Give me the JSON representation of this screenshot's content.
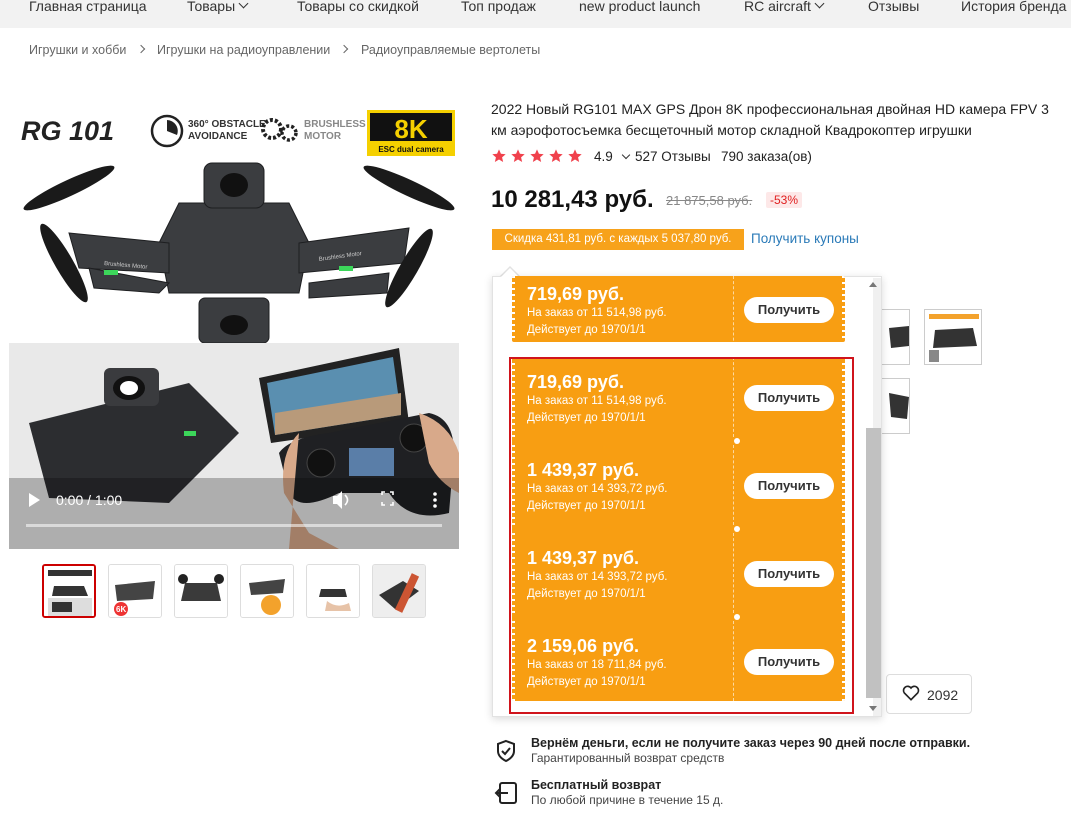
{
  "nav": {
    "items": [
      {
        "label": "Главная страница",
        "has_menu": false
      },
      {
        "label": "Товары",
        "has_menu": true
      },
      {
        "label": "Товары со скидкой",
        "has_menu": false
      },
      {
        "label": "Топ продаж",
        "has_menu": false
      },
      {
        "label": "new product launch",
        "has_menu": false
      },
      {
        "label": "RC aircraft",
        "has_menu": true
      },
      {
        "label": "Отзывы",
        "has_menu": false
      },
      {
        "label": "История бренда",
        "has_menu": false
      }
    ]
  },
  "breadcrumb": [
    "Игрушки и хобби",
    "Игрушки на радиоуправлении",
    "Радиоуправляемые вертолеты"
  ],
  "media": {
    "banner": {
      "brand": "RG 101",
      "feature1": "360° OBSTACLE AVOIDANCE",
      "feature1_line1": "360° OBSTACLE",
      "feature1_line2": "AVOIDANCE",
      "feature2_line1": "BRUSHLESS",
      "feature2_line2": "MOTOR",
      "badge_big": "8K",
      "badge_small": "ESC dual camera",
      "motor_label": "Brushless Motor"
    },
    "video": {
      "time": "0:00 / 1:00"
    },
    "thumb_count": 6,
    "thumb2_badge": "6K"
  },
  "product": {
    "title": "2022 Новый RG101 MAX GPS Дрон 8K профессиональная двойная HD камера FPV 3 км аэрофотосъемка бесщеточный мотор складной Квадрокоптер игрушки",
    "rating": "4.9",
    "stars": 5,
    "reviews": "527 Отзывы",
    "orders": "790 заказа(ов)",
    "price": "10 281,43 руб.",
    "old_price": "21 875,58 руб.",
    "discount": "-53%",
    "coupon_strip": "Скидка 431,81 руб. с каждых 5 037,80 руб.",
    "get_coupons": "Получить купоны",
    "wishlist_count": "2092"
  },
  "coupons": [
    {
      "amount": "719,69 руб.",
      "min_order": "На заказ от 11 514,98 руб.",
      "valid": "Действует до 1970/1/1",
      "button": "Получить"
    },
    {
      "amount": "719,69 руб.",
      "min_order": "На заказ от 11 514,98 руб.",
      "valid": "Действует до 1970/1/1",
      "button": "Получить"
    },
    {
      "amount": "1 439,37 руб.",
      "min_order": "На заказ от 14 393,72 руб.",
      "valid": "Действует до 1970/1/1",
      "button": "Получить"
    },
    {
      "amount": "1 439,37 руб.",
      "min_order": "На заказ от 14 393,72 руб.",
      "valid": "Действует до 1970/1/1",
      "button": "Получить"
    },
    {
      "amount": "2 159,06 руб.",
      "min_order": "На заказ от 18 711,84 руб.",
      "valid": "Действует до 1970/1/1",
      "button": "Получить"
    }
  ],
  "guarantees": [
    {
      "title": "Вернём деньги, если не получите заказ через 90 дней после отправки.",
      "sub": "Гарантированный возврат средств",
      "icon": "shield-check-icon"
    },
    {
      "title": "Бесплатный возврат",
      "sub": "По любой причине в течение 15 д.",
      "icon": "return-arrow-icon"
    }
  ],
  "colors": {
    "coupon_orange": "#f89e12",
    "highlight_red": "#d0141c",
    "link_blue": "#2a7ab8",
    "star_red": "#f0414c"
  }
}
